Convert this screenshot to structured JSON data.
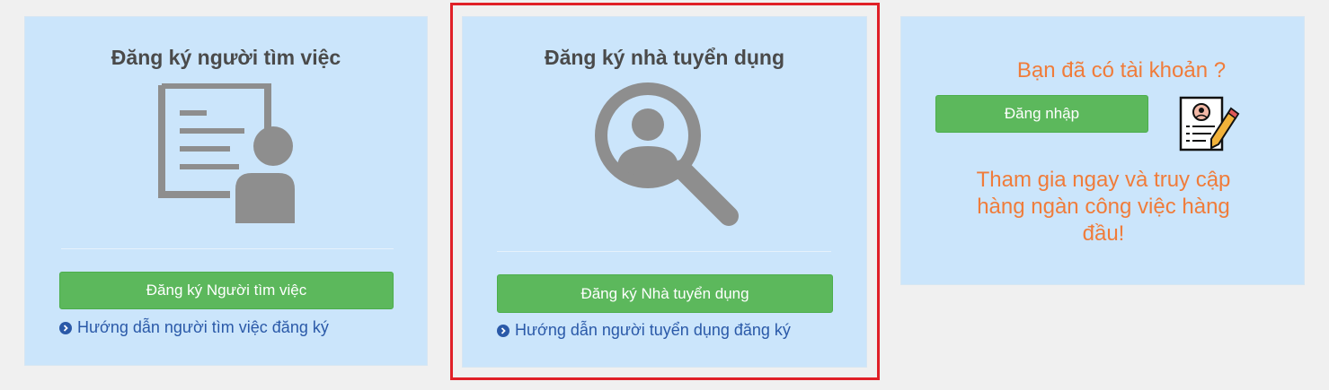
{
  "seeker_card": {
    "title": "Đăng ký người tìm việc",
    "icon": "resume-person-icon",
    "register_button": "Đăng ký Người tìm việc",
    "guide_link": "Hướng dẫn người tìm việc đăng ký"
  },
  "employer_card": {
    "title": "Đăng ký nhà tuyển dụng",
    "icon": "magnifier-person-icon",
    "register_button": "Đăng ký Nhà tuyển dụng",
    "guide_link": "Hướng dẫn người tuyển dụng đăng ký"
  },
  "login_card": {
    "question": "Bạn đã có tài khoản ?",
    "login_button": "Đăng nhập",
    "icon": "cv-pencil-icon",
    "tagline": "Tham gia ngay và truy cập hàng ngàn công việc hàng đầu!"
  },
  "colors": {
    "card_bg": "#cbe5fb",
    "button_green": "#5cb85c",
    "link_blue": "#2a59a8",
    "accent_orange": "#f07c3a",
    "highlight_red": "#e02027",
    "icon_gray": "#8e8e8e"
  }
}
